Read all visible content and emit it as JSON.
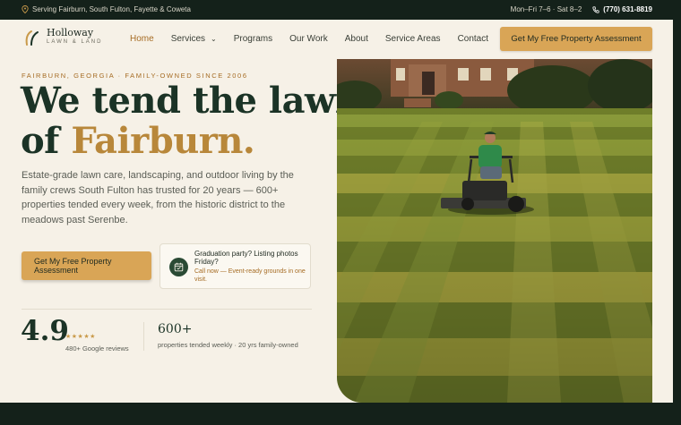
{
  "topbar": {
    "service_area": "Serving Fairburn, South Fulton, Fayette & Coweta",
    "hours": "Mon–Fri 7–6 · Sat 8–2",
    "phone": "(770) 631-8819"
  },
  "brand": {
    "name": "Holloway",
    "sub": "LAWN & LAND"
  },
  "nav": {
    "items": [
      {
        "label": "Home",
        "active": true
      },
      {
        "label": "Services",
        "dropdown": true
      },
      {
        "label": "Programs"
      },
      {
        "label": "Our Work"
      },
      {
        "label": "About"
      },
      {
        "label": "Service Areas"
      },
      {
        "label": "Contact"
      }
    ],
    "cta": "Get My Free Property Assessment"
  },
  "hero": {
    "eyebrow": "FAIRBURN, GEORGIA · FAMILY-OWNED SINCE 2006",
    "headline_line1": "We tend the lawns",
    "headline_of": "of",
    "headline_accent": "Fairburn.",
    "lede": "Estate-grade lawn care, landscaping, and outdoor living by the family crews South Fulton has trusted for 20 years — 600+ properties tended every week, from the historic district to the meadows past Serenbe.",
    "cta": "Get My Free Property Assessment",
    "promo_title": "Graduation party? Listing photos Friday?",
    "promo_sub": "Call now — Event-ready grounds in one visit."
  },
  "stats": {
    "rating": "4.9",
    "stars": "★★★★★",
    "reviews": "480+ Google reviews",
    "count": "600+",
    "count_label": "properties tended weekly · 20 yrs family-owned"
  },
  "colors": {
    "accent": "#d9a556",
    "dark": "#14211a",
    "headline": "#1b3326",
    "cream": "#f6f1e7"
  }
}
